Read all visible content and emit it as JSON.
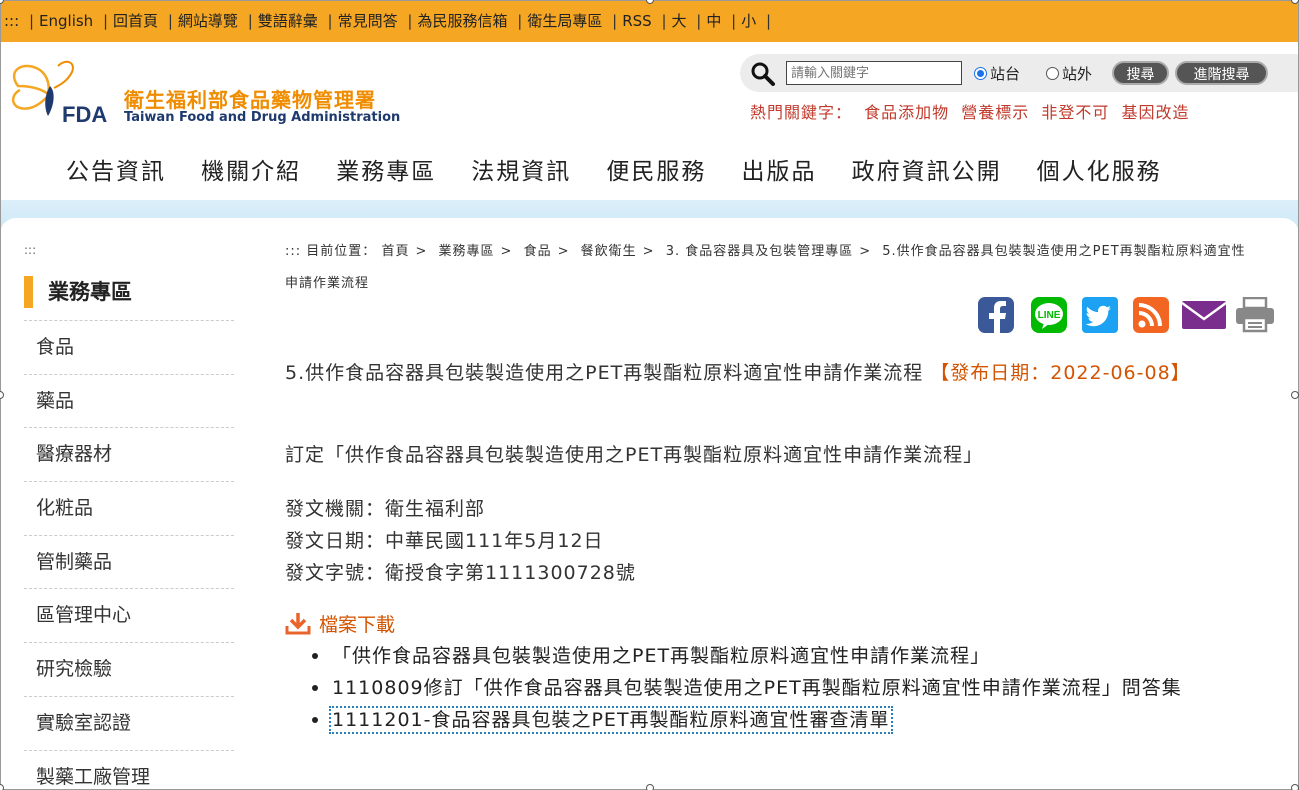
{
  "topbar": {
    "prefix": ":::",
    "links": [
      "English",
      "回首頁",
      "網站導覽",
      "雙語辭彙",
      "常見問答",
      "為民服務信箱",
      "衛生局專區",
      "RSS",
      "大",
      "中",
      "小"
    ]
  },
  "logo": {
    "name_zh": "衛生福利部食品藥物管理署",
    "name_en": "Taiwan Food and Drug Administration",
    "mark_text": "FDA"
  },
  "search": {
    "placeholder": "請輸入關鍵字",
    "option_site": "站台",
    "option_external": "站外",
    "search_label": "搜尋",
    "advanced_label": "進階搜尋"
  },
  "hot_keywords": {
    "label": "熱門關鍵字：",
    "items": [
      "食品添加物",
      "營養標示",
      "非登不可",
      "基因改造"
    ]
  },
  "main_nav": [
    "公告資訊",
    "機關介紹",
    "業務專區",
    "法規資訊",
    "便民服務",
    "出版品",
    "政府資訊公開",
    "個人化服務"
  ],
  "sidebar": {
    "dots": ":::",
    "title": "業務專區",
    "items": [
      "食品",
      "藥品",
      "醫療器材",
      "化粧品",
      "管制藥品",
      "區管理中心",
      "研究檢驗",
      "實驗室認證",
      "製藥工廠管理"
    ]
  },
  "breadcrumb": {
    "prefix": ":::",
    "label": "目前位置：",
    "items": [
      "首頁",
      "業務專區",
      "食品",
      "餐飲衛生",
      "3. 食品容器具及包裝管理專區",
      "5.供作食品容器具包裝製造使用之PET再製酯粒原料適宜性申請作業流程"
    ]
  },
  "share_icons": [
    "facebook-icon",
    "line-icon",
    "twitter-icon",
    "rss-icon",
    "email-icon",
    "print-icon"
  ],
  "colors": {
    "topbar": "#f5a623",
    "accent_orange": "#d35400",
    "facebook": "#3b5998",
    "line": "#00b900",
    "twitter": "#1da1f2",
    "rss": "#f26522",
    "email": "#7b2d8e",
    "print": "#888888"
  },
  "article": {
    "title": "5.供作食品容器具包裝製造使用之PET再製酯粒原料適宜性申請作業流程",
    "date_label": "【發布日期：2022-06-08】",
    "description": "訂定「供作食品容器具包裝製造使用之PET再製酯粒原料適宜性申請作業流程」",
    "meta": [
      "發文機關：衛生福利部",
      "發文日期：中華民國111年5月12日",
      "發文字號：衛授食字第1111300728號"
    ]
  },
  "downloads": {
    "heading": "檔案下載",
    "items": [
      "「供作食品容器具包裝製造使用之PET再製酯粒原料適宜性申請作業流程」",
      "1110809修訂「供作食品容器具包裝製造使用之PET再製酯粒原料適宜性申請作業流程」問答集",
      "1111201-食品容器具包裝之PET再製酯粒原料適宜性審查清單"
    ]
  }
}
